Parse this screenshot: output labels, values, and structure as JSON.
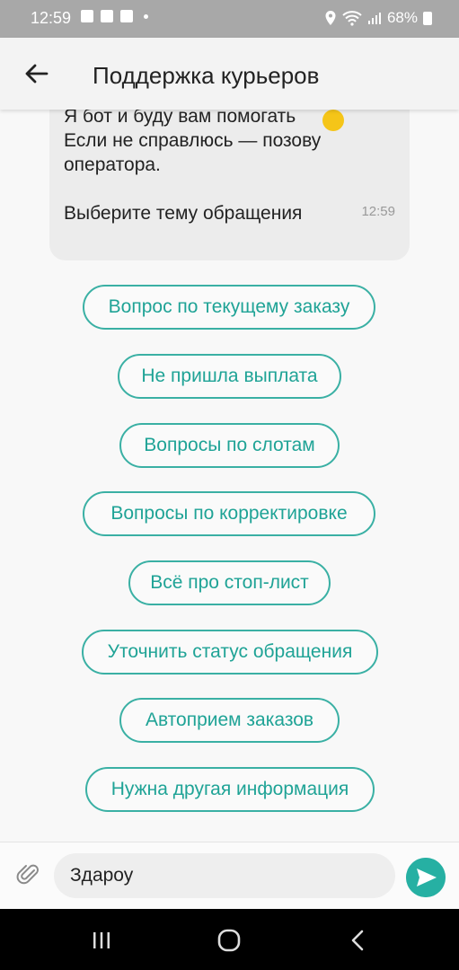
{
  "status_bar": {
    "time": "12:59",
    "battery": "68%"
  },
  "header": {
    "title": "Поддержка курьеров"
  },
  "message": {
    "text": "Я бот и буду вам помогать\nЕсли не справлюсь — позову оператора.\n\nВыберите тему обращения",
    "time": "12:59"
  },
  "quick_replies": [
    "Вопрос по текущему заказу",
    "Не пришла выплата",
    "Вопросы по слотам",
    "Вопросы по корректировке",
    "Всё про стоп-лист",
    "Уточнить статус обращения",
    "Автоприем заказов",
    "Нужна другая информация"
  ],
  "composer": {
    "value": "Здароу"
  },
  "icons": [
    "back-arrow-icon",
    "paperclip-icon",
    "send-icon",
    "recents-icon",
    "home-icon",
    "nav-back-icon",
    "smile-emoji-icon"
  ],
  "colors": {
    "accent": "#26b0a3",
    "chip_text": "#1fa396",
    "status_bar": "#a8a8a8"
  }
}
